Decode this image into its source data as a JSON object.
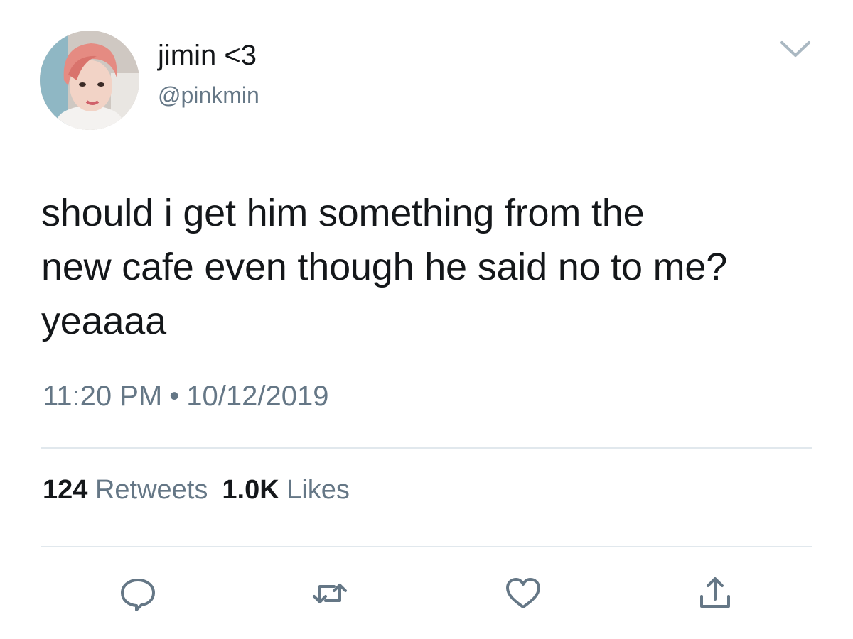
{
  "user": {
    "display_name": "jimin <3",
    "handle": "@pinkmin",
    "avatar_icon": "profile-photo"
  },
  "tweet": {
    "text_lines": [
      "should i get him something from the",
      "new cafe even though he said no to me?",
      "yeaaaa"
    ],
    "time": "11:20 PM",
    "separator": "•",
    "date": "10/12/2019"
  },
  "stats": {
    "retweets_count": "124",
    "retweets_label": "Retweets",
    "likes_count": "1.0K",
    "likes_label": "Likes"
  },
  "actions": [
    {
      "name": "reply",
      "icon": "reply-icon"
    },
    {
      "name": "retweet",
      "icon": "retweet-icon"
    },
    {
      "name": "like",
      "icon": "heart-icon"
    },
    {
      "name": "share",
      "icon": "share-icon"
    }
  ],
  "colors": {
    "text_primary": "#14171a",
    "text_secondary": "#657786",
    "divider": "#e1e8ed",
    "icon": "#657786"
  }
}
